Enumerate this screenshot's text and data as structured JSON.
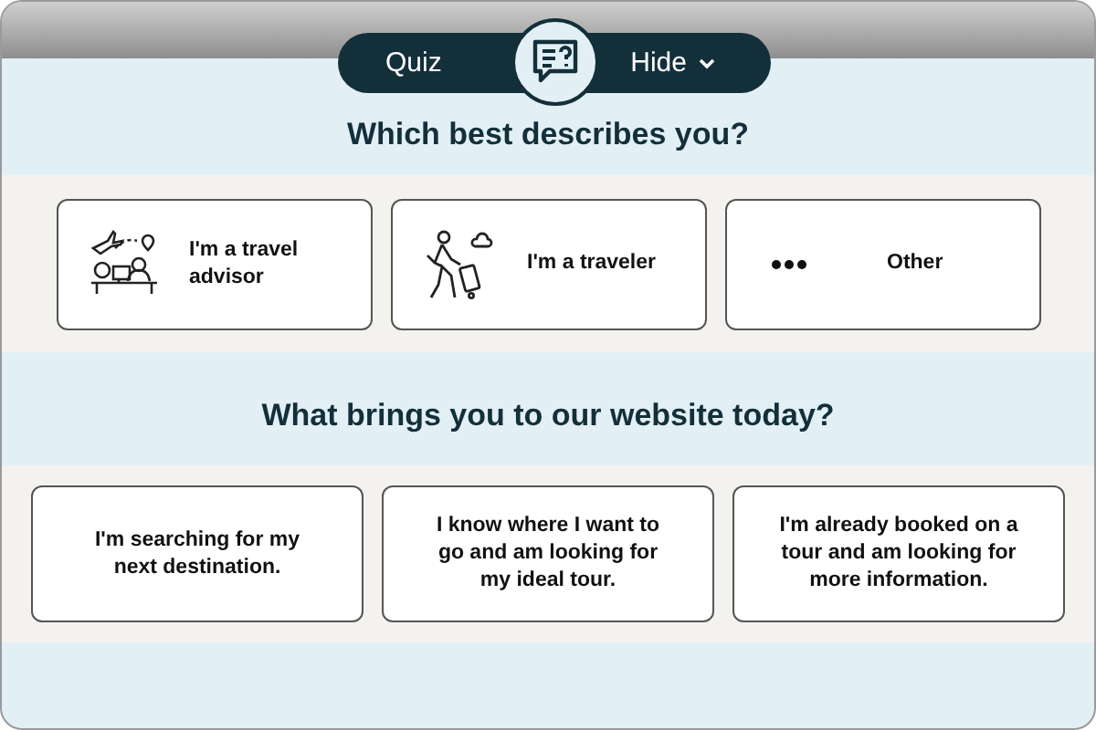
{
  "toolbar": {
    "tab_label": "Quiz",
    "hide_label": "Hide"
  },
  "questions": [
    {
      "title": "Which best describes you?",
      "options": [
        {
          "kind": "advisor",
          "label": "I'm a travel advisor"
        },
        {
          "kind": "traveler",
          "label": "I'm a traveler"
        },
        {
          "kind": "other",
          "label": "Other"
        }
      ]
    },
    {
      "title": "What brings you to our website today?",
      "options": [
        {
          "kind": "text",
          "label": "I'm searching for my next destination."
        },
        {
          "kind": "text",
          "label": "I know where I want to go and am looking for my ideal tour."
        },
        {
          "kind": "text",
          "label": "I'm already booked on a tour and am looking for more information."
        }
      ]
    }
  ]
}
